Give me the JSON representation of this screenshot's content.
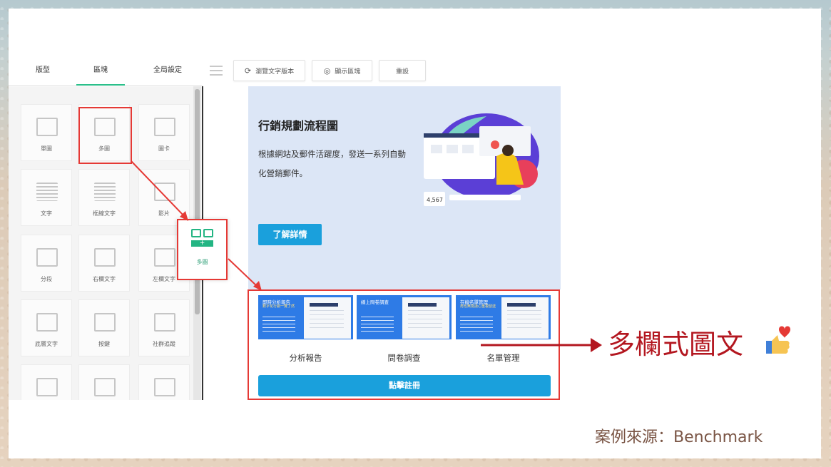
{
  "tabs": [
    "版型",
    "區塊",
    "全局設定"
  ],
  "toolbar": {
    "preview_text": "瀏覽文字版本",
    "show_blocks": "顯示區塊",
    "reset": "重設"
  },
  "tiles": [
    "單圖",
    "多圖",
    "圖卡",
    "文字",
    "框線文字",
    "影片",
    "分段",
    "右欄文字",
    "左欄文字",
    "底層文字",
    "按鍵",
    "社群追蹤",
    "",
    "",
    ""
  ],
  "drag_tile_label": "多圖",
  "hero": {
    "title": "行銷規劃流程圖",
    "description": "根據網站及郵件活躍度，發送一系列自動化營銷郵件。",
    "button": "了解詳情",
    "stat": "4,567"
  },
  "columns": [
    {
      "thumb_title": "即時分析報告",
      "thumb_sub": "數字化行銷一覽了然",
      "label": "分析報告"
    },
    {
      "thumb_title": "線上問卷調查",
      "thumb_sub": "",
      "label": "問卷調查"
    },
    {
      "thumb_title": "在線名單管理",
      "thumb_sub": "再也無需擔心重複發送",
      "label": "名單管理"
    }
  ],
  "register_button": "點擊註冊",
  "callout": "多欄式圖文",
  "source": "案例來源：Benchmark",
  "colors": {
    "accent_green": "#2bbf8a",
    "highlight_red": "#e53935",
    "button_blue": "#1aa0dc",
    "callout_red": "#b3161f"
  }
}
